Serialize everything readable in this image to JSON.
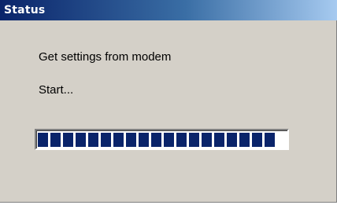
{
  "window": {
    "title": "Status"
  },
  "messages": [
    {
      "text": "Get settings from modem"
    },
    {
      "text": "Start..."
    }
  ],
  "progress": {
    "fraction": 1.0,
    "total_blocks": 19,
    "filled_blocks": 19,
    "bar_color": "#0a246a"
  },
  "colors": {
    "title_gradient_start": "#0a246a",
    "title_gradient_end": "#a6caf0",
    "dialog_face": "#d4d0c8"
  }
}
